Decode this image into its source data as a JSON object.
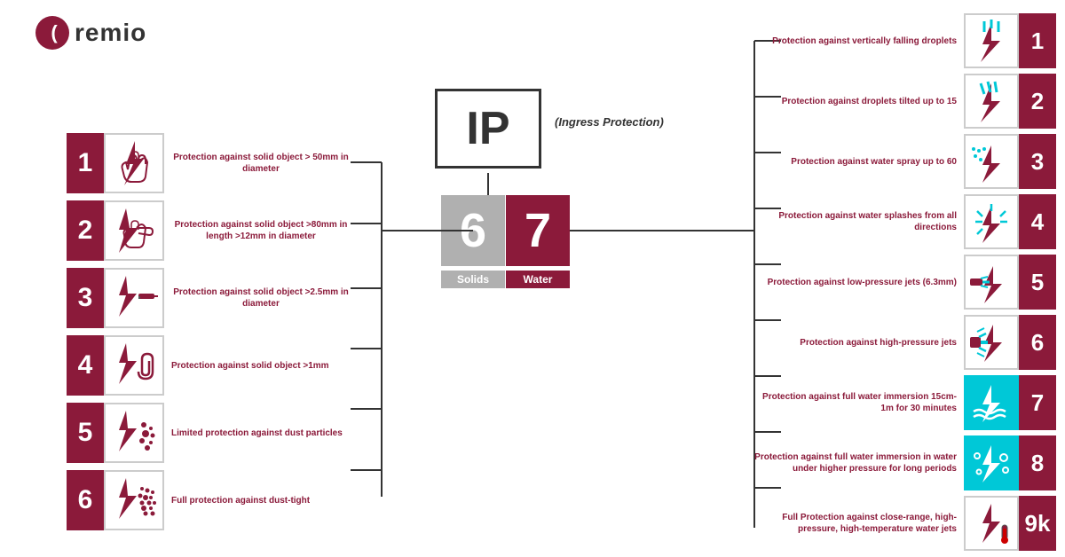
{
  "logo": {
    "circle_letter": "(",
    "text": "remio"
  },
  "ip_box": {
    "text": "IP",
    "ingress_label": "(Ingress Protection)"
  },
  "digits": {
    "left": "6",
    "right": "7"
  },
  "labels": {
    "solids": "Solids",
    "water": "Water"
  },
  "left_items": [
    {
      "number": "1",
      "desc": "Protection against solid object > 50mm in diameter"
    },
    {
      "number": "2",
      "desc": "Protection against solid object >80mm in length >12mm in diameter"
    },
    {
      "number": "3",
      "desc": "Protection against solid object >2.5mm in diameter"
    },
    {
      "number": "4",
      "desc": "Protection against solid object >1mm"
    },
    {
      "number": "5",
      "desc": "Limited protection against dust particles"
    },
    {
      "number": "6",
      "desc": "Full protection against dust-tight"
    }
  ],
  "right_items": [
    {
      "number": "1",
      "desc": "Protection against vertically falling droplets",
      "highlight": false
    },
    {
      "number": "2",
      "desc": "Protection against droplets tilted up to 15",
      "highlight": false
    },
    {
      "number": "3",
      "desc": "Protection against water spray up to 60",
      "highlight": false
    },
    {
      "number": "4",
      "desc": "Protection against water splashes from all directions",
      "highlight": false
    },
    {
      "number": "5",
      "desc": "Protection against low-pressure jets (6.3mm)",
      "highlight": false
    },
    {
      "number": "6",
      "desc": "Protection against high-pressure jets",
      "highlight": false
    },
    {
      "number": "7",
      "desc": "Protection against full water immersion 15cm-1m for 30 minutes",
      "highlight": true
    },
    {
      "number": "8",
      "desc": "Protection against full water immersion in water under higher pressure for long periods",
      "highlight": true
    },
    {
      "number": "9k",
      "desc": "Full Protection against close-range, high-pressure, high-temperature water jets",
      "highlight": false
    }
  ]
}
